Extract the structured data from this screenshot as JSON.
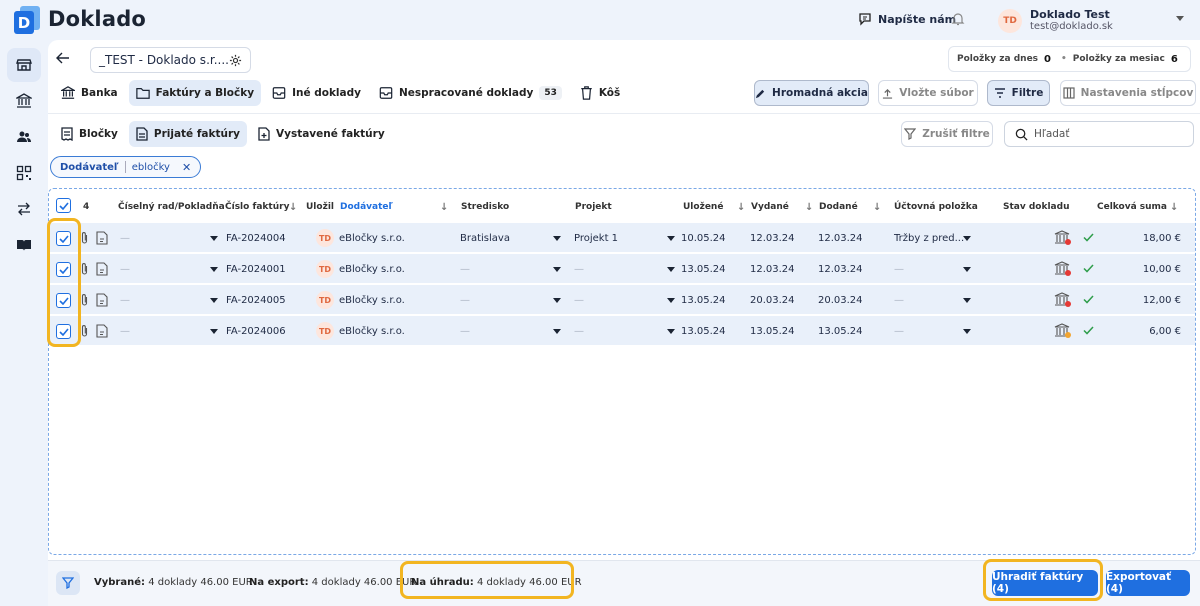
{
  "app": {
    "brand": "Doklado",
    "logo_letter": "D"
  },
  "topbar": {
    "write_us": "Napíšte nám",
    "user_initials": "TD",
    "user_name": "Doklado Test",
    "user_email": "test@doklado.sk"
  },
  "sidebar": {
    "items": [
      "store-icon",
      "bank-icon",
      "users-icon",
      "qr-code-icon",
      "transfer-icon",
      "book-icon"
    ]
  },
  "company": {
    "name": "_TEST - Doklado s.r...."
  },
  "stats": {
    "today_label": "Položky za dnes",
    "today_value": "0",
    "month_label": "Položky za mesiac",
    "month_value": "6"
  },
  "tabs1": [
    {
      "label": "Banka"
    },
    {
      "label": "Faktúry a Bločky"
    },
    {
      "label": "Iné doklady"
    },
    {
      "label": "Nespracované doklady",
      "badge": "53"
    },
    {
      "label": "Kôš"
    }
  ],
  "actions": {
    "bulk": "Hromadná akcia",
    "upload": "Vložte súbor",
    "filters": "Filtre",
    "columns": "Nastavenia stĺpcov"
  },
  "tabs2": [
    {
      "label": "Bločky"
    },
    {
      "label": "Prijaté faktúry"
    },
    {
      "label": "Vystavené faktúry"
    }
  ],
  "clear_filters": "Zrušiť filtre",
  "search": {
    "placeholder": "Hľadať"
  },
  "filter_chip": {
    "key": "Dodávateľ",
    "value": "ebločky"
  },
  "table": {
    "selected_count": "4",
    "headers": {
      "series": "Číselný rad/Pokladňa",
      "number": "Číslo faktúry",
      "saved_by": "Uložil",
      "supplier": "Dodávateľ",
      "center": "Stredisko",
      "project": "Projekt",
      "stored": "Uložené",
      "issued": "Vydané",
      "delivered": "Dodané",
      "account": "Účtovná položka",
      "status": "Stav dokladu",
      "total": "Celková suma"
    },
    "rows": [
      {
        "series": "—",
        "number": "FA-2024004",
        "initials": "TD",
        "supplier": "eBločky s.r.o.",
        "center": "Bratislava",
        "project": "Projekt 1",
        "stored": "10.05.24",
        "issued": "12.03.24",
        "delivered": "12.03.24",
        "account": "Tržby z pred...",
        "status_color": "#e53935",
        "total": "18,00 €"
      },
      {
        "series": "—",
        "number": "FA-2024001",
        "initials": "TD",
        "supplier": "eBločky s.r.o.",
        "center": "—",
        "project": "—",
        "stored": "13.05.24",
        "issued": "12.03.24",
        "delivered": "12.03.24",
        "account": "—",
        "status_color": "#e53935",
        "total": "10,00 €"
      },
      {
        "series": "—",
        "number": "FA-2024005",
        "initials": "TD",
        "supplier": "eBločky s.r.o.",
        "center": "—",
        "project": "—",
        "stored": "13.05.24",
        "issued": "20.03.24",
        "delivered": "20.03.24",
        "account": "—",
        "status_color": "#e53935",
        "total": "12,00 €"
      },
      {
        "series": "—",
        "number": "FA-2024006",
        "initials": "TD",
        "supplier": "eBločky s.r.o.",
        "center": "—",
        "project": "—",
        "stored": "13.05.24",
        "issued": "13.05.24",
        "delivered": "13.05.24",
        "account": "—",
        "status_color": "#f2a531",
        "total": "6,00 €"
      }
    ]
  },
  "footer": {
    "selected_label": "Vybrané:",
    "selected_value": "4 doklady 46.00 EUR",
    "export_label": "Na export:",
    "export_value": "4 doklady 46.00 EUR",
    "pay_label": "Na úhradu:",
    "pay_value": "4 doklady 46.00 EUR",
    "pay_button": "Uhradiť faktúry (4)",
    "export_button": "Exportovať (4)"
  },
  "colors": {
    "accent": "#1f6fe0",
    "highlight": "#f2b521",
    "row_bg": "#e9f0fa"
  }
}
